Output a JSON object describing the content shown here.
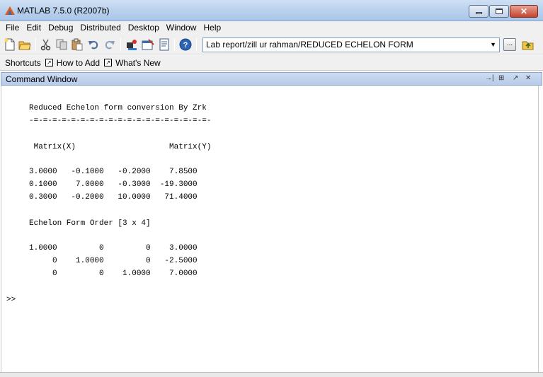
{
  "window": {
    "title": "MATLAB  7.5.0 (R2007b)",
    "close_glyph": "✕"
  },
  "menu": [
    "File",
    "Edit",
    "Debug",
    "Distributed",
    "Desktop",
    "Window",
    "Help"
  ],
  "toolbar": {
    "current_directory": "Lab report/zill ur rahman/REDUCED ECHELON FORM",
    "browse_label": "...",
    "dropdown_glyph": "▼",
    "icons": [
      "new-file-icon",
      "open-icon",
      "cut-icon",
      "copy-icon",
      "paste-icon",
      "undo-icon",
      "redo-icon",
      "simulink-icon",
      "guide-icon",
      "profiler-icon",
      "help-icon",
      "up-folder-icon"
    ]
  },
  "shortcuts": {
    "label": "Shortcuts",
    "items": [
      "How to Add",
      "What's New"
    ]
  },
  "command_window": {
    "title": "Command Window",
    "controls": [
      "→|",
      "⊞",
      "↗",
      "✕"
    ],
    "lines": [
      "Reduced Echelon form conversion By Zrk",
      "-=-=-=-=-=-=-=-=-=-=-=-=-=-=-=-=-=-=-=-",
      " Matrix(X)                    Matrix(Y)",
      "3.0000   -0.1000   -0.2000    7.8500",
      "0.1000    7.0000   -0.3000  -19.3000",
      "0.3000   -0.2000   10.0000   71.4000",
      "Echelon Form Order [3 x 4]",
      "1.0000         0         0    3.0000",
      "     0    1.0000         0   -2.5000",
      "     0         0    1.0000    7.0000",
      ">>"
    ]
  }
}
